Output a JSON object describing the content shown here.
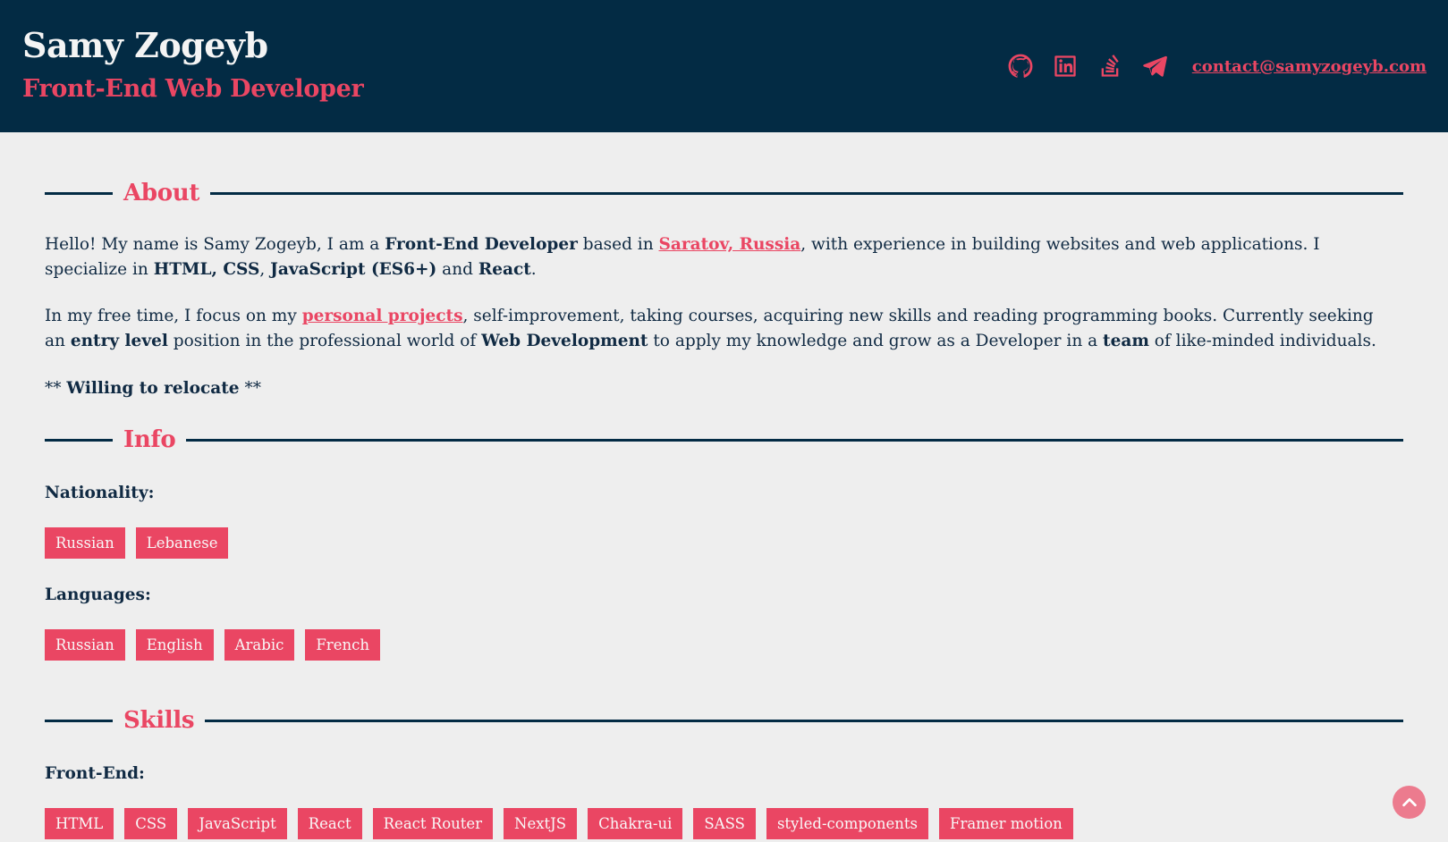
{
  "header": {
    "name": "Samy Zogeyb",
    "role": "Front-End Web Developer",
    "social": [
      {
        "icon": "github-icon"
      },
      {
        "icon": "linkedin-icon"
      },
      {
        "icon": "stackoverflow-icon"
      },
      {
        "icon": "telegram-icon"
      }
    ],
    "email": "contact@samyzogeyb.com"
  },
  "about": {
    "title": "About",
    "p1": {
      "t1": "Hello! My name is Samy Zogeyb, I am a ",
      "b1": "Front-End Developer",
      "t2": " based in ",
      "link": "Saratov, Russia",
      "t3": ", with experience in building websites and web applications. I specialize in ",
      "b2": "HTML, CSS",
      "t4": ", ",
      "b3": "JavaScript (ES6+)",
      "t5": " and ",
      "b4": "React",
      "t6": "."
    },
    "p2": {
      "t1": "In my free time, I focus on my ",
      "link": "personal projects",
      "t2": ", self-improvement, taking courses, acquiring new skills and reading programming books. Currently seeking an ",
      "b1": "entry level",
      "t3": " position in the professional world of ",
      "b2": "Web Development",
      "t4": " to apply my knowledge and grow as a Developer in a ",
      "b3": "team",
      "t5": " of like-minded individuals."
    },
    "relocate": {
      "prefix": "** ",
      "bold": "Willing to relocate",
      "suffix": " **"
    }
  },
  "info": {
    "title": "Info",
    "nationality_label": "Nationality:",
    "nationality": [
      "Russian",
      "Lebanese"
    ],
    "languages_label": "Languages:",
    "languages": [
      "Russian",
      "English",
      "Arabic",
      "French"
    ]
  },
  "skills": {
    "title": "Skills",
    "frontend_label": "Front-End:",
    "frontend": [
      "HTML",
      "CSS",
      "JavaScript",
      "React",
      "React Router",
      "NextJS",
      "Chakra-ui",
      "SASS",
      "styled-components",
      "Framer motion"
    ]
  },
  "colors": {
    "header_bg": "#032b44",
    "accent": "#ea4663",
    "page_bg": "#eeeeee",
    "text": "#102a43"
  }
}
